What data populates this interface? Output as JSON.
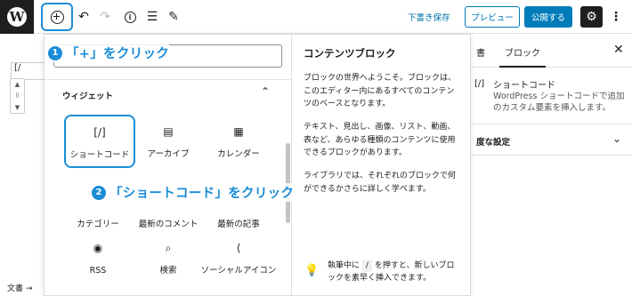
{
  "toolbar": {
    "draft_label": "下書き保存",
    "preview_label": "プレビュー",
    "publish_label": "公開する",
    "icons": [
      "wordpress-logo",
      "add-block-icon",
      "undo-icon",
      "redo-icon",
      "info-icon",
      "list-view-icon",
      "edit-icon",
      "gear-icon",
      "more-icon"
    ]
  },
  "sidebar": {
    "tab_doc": "書",
    "tab_block": "ブロック",
    "close": "✕",
    "block_icon": "[/]",
    "block_title": "ショートコード",
    "block_desc": "WordPress ショートコードで追加のカスタム要素を挿入します。",
    "section_label": "度な設定"
  },
  "inserter": {
    "search_value": "&",
    "group_title": "ウィジェット",
    "items": [
      {
        "label": "ショートコード",
        "icon": "[/]"
      },
      {
        "label": "アーカイブ",
        "icon": "▤"
      },
      {
        "label": "カレンダー",
        "icon": "▦"
      },
      {
        "label": "カテゴリー",
        "icon": ""
      },
      {
        "label": "最新のコメント",
        "icon": ""
      },
      {
        "label": "最新の記事",
        "icon": ""
      },
      {
        "label": "RSS",
        "icon": "◉"
      },
      {
        "label": "検索",
        "icon": "⌕"
      },
      {
        "label": "ソーシャルアイコン",
        "icon": "⟨"
      }
    ]
  },
  "help": {
    "title": "コンテンツブロック",
    "p1": "ブロックの世界へようこそ。ブロックは、このエディター内にあるすべてのコンテンツのベースとなります。",
    "p2": "テキスト、見出し、画像、リスト、動画、表など、あらゆる種類のコンテンツに使用できるブロックがあります。",
    "p3": "ライブラリでは、それぞれのブロックで何ができるかさらに詳しく学べます。",
    "tip_pre": "執筆中に",
    "tip_key": "/",
    "tip_post": "を押すと、新しいブロックを素早く挿入できます。"
  },
  "annotations": {
    "step1_num": "1",
    "step1_text": "「+」をクリック",
    "step2_num": "2",
    "step2_text": "「ショートコード」をクリック"
  },
  "editor": {
    "left_text": "[/",
    "footer": "文書 →"
  },
  "colors": {
    "accent": "#1a8cd8",
    "wp_blue": "#007cba"
  }
}
